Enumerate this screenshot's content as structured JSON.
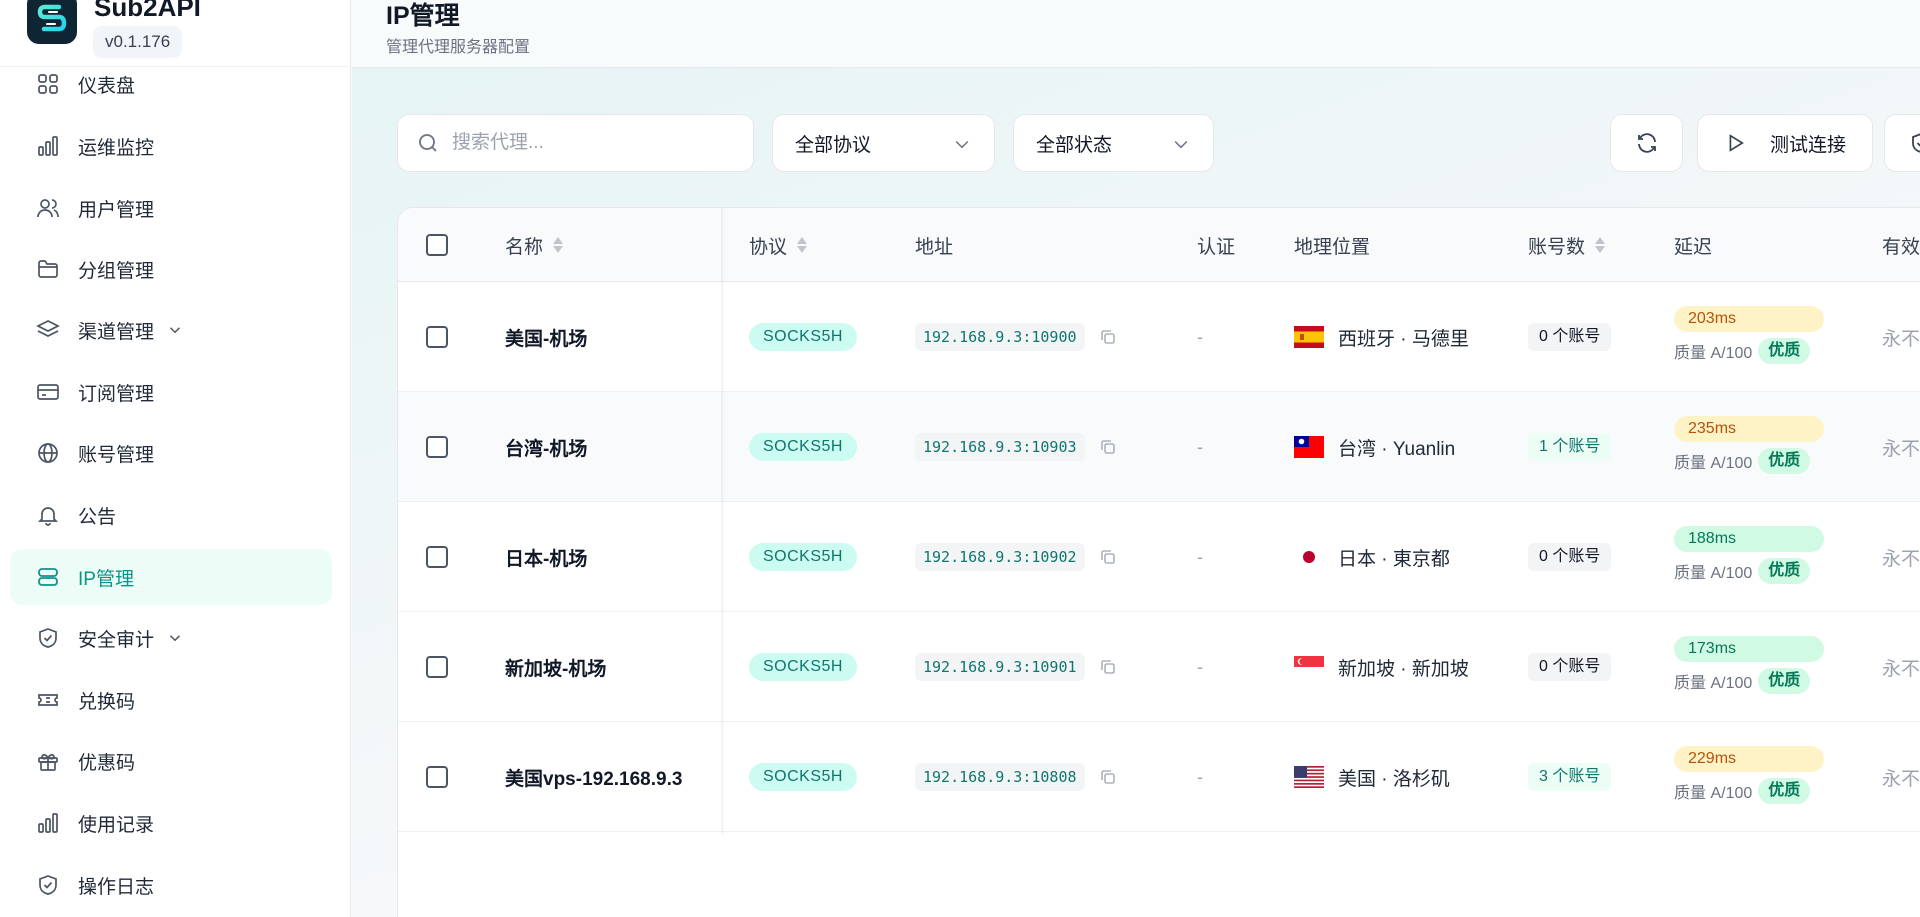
{
  "app": {
    "name": "Sub2API",
    "version": "v0.1.176"
  },
  "header": {
    "title": "IP管理",
    "subtitle": "管理代理服务器配置"
  },
  "sidebar": {
    "items": [
      {
        "label": "仪表盘",
        "icon": "grid-icon"
      },
      {
        "label": "运维监控",
        "icon": "bar-chart-icon"
      },
      {
        "label": "用户管理",
        "icon": "users-icon"
      },
      {
        "label": "分组管理",
        "icon": "folder-icon"
      },
      {
        "label": "渠道管理",
        "icon": "layers-icon",
        "expandable": true
      },
      {
        "label": "订阅管理",
        "icon": "credit-card-icon"
      },
      {
        "label": "账号管理",
        "icon": "globe-icon"
      },
      {
        "label": "公告",
        "icon": "bell-icon"
      },
      {
        "label": "IP管理",
        "icon": "database-icon",
        "active": true
      },
      {
        "label": "安全审计",
        "icon": "shield-icon",
        "expandable": true
      },
      {
        "label": "兑换码",
        "icon": "ticket-icon"
      },
      {
        "label": "优惠码",
        "icon": "gift-icon"
      },
      {
        "label": "使用记录",
        "icon": "bar-chart-icon"
      },
      {
        "label": "操作日志",
        "icon": "shield-icon"
      }
    ]
  },
  "toolbar": {
    "search_placeholder": "搜索代理...",
    "protocol_filter": "全部协议",
    "status_filter": "全部状态",
    "test_label": "测试连接"
  },
  "table": {
    "columns": {
      "name": "名称",
      "protocol": "协议",
      "address": "地址",
      "auth": "认证",
      "geo": "地理位置",
      "accounts": "账号数",
      "latency": "延迟",
      "expiry": "有效"
    },
    "rows": [
      {
        "name": "美国-机场",
        "protocol": "SOCKS5H",
        "address": "192.168.9.3:10900",
        "auth": "-",
        "flag": "es",
        "geo": "西班牙 · 马德里",
        "accounts": "0 个账号",
        "latency": "203ms",
        "latency_level": "yellow",
        "quality": "质量 A/100",
        "quality_badge": "优质",
        "expiry": "永不"
      },
      {
        "name": "台湾-机场",
        "protocol": "SOCKS5H",
        "address": "192.168.9.3:10903",
        "auth": "-",
        "flag": "tw",
        "geo": "台湾 · Yuanlin",
        "accounts": "1 个账号",
        "latency": "235ms",
        "latency_level": "yellow",
        "quality": "质量 A/100",
        "quality_badge": "优质",
        "expiry": "永不"
      },
      {
        "name": "日本-机场",
        "protocol": "SOCKS5H",
        "address": "192.168.9.3:10902",
        "auth": "-",
        "flag": "jp",
        "geo": "日本 · 東京都",
        "accounts": "0 个账号",
        "latency": "188ms",
        "latency_level": "green",
        "quality": "质量 A/100",
        "quality_badge": "优质",
        "expiry": "永不"
      },
      {
        "name": "新加坡-机场",
        "protocol": "SOCKS5H",
        "address": "192.168.9.3:10901",
        "auth": "-",
        "flag": "sg",
        "geo": "新加坡 · 新加坡",
        "accounts": "0 个账号",
        "latency": "173ms",
        "latency_level": "green",
        "quality": "质量 A/100",
        "quality_badge": "优质",
        "expiry": "永不"
      },
      {
        "name": "美国vps-192.168.9.3",
        "protocol": "SOCKS5H",
        "address": "192.168.9.3:10808",
        "auth": "-",
        "flag": "us",
        "geo": "美国 · 洛杉矶",
        "accounts": "3 个账号",
        "latency": "229ms",
        "latency_level": "yellow",
        "quality": "质量 A/100",
        "quality_badge": "优质",
        "expiry": "永不"
      }
    ]
  },
  "colors": {
    "accent": "#0d9488",
    "accent_bg": "#ecfdf8"
  }
}
